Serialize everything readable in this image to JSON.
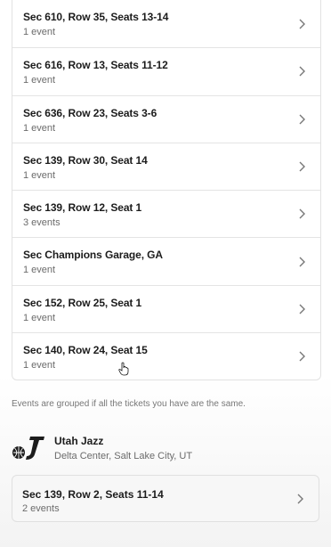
{
  "rows": [
    {
      "title": "Sec 610, Row 35, Seats 13-14",
      "sub": "1 event"
    },
    {
      "title": "Sec 616, Row 13, Seats 11-12",
      "sub": "1 event"
    },
    {
      "title": "Sec 636, Row 23, Seats 3-6",
      "sub": "1 event"
    },
    {
      "title": "Sec 139, Row 30, Seat 14",
      "sub": "1 event"
    },
    {
      "title": "Sec 139, Row 12, Seat 1",
      "sub": "3 events"
    },
    {
      "title": "Sec Champions Garage, GA",
      "sub": "1 event"
    },
    {
      "title": "Sec 152, Row 25, Seat 1",
      "sub": "1 event"
    },
    {
      "title": "Sec 140, Row 24, Seat 15",
      "sub": "1 event"
    }
  ],
  "note": "Events are grouped if all the tickets you have are the same.",
  "team": {
    "name": "Utah Jazz",
    "venue": "Delta Center, Salt Lake City, UT",
    "logo_icon": "utah-jazz-logo"
  },
  "team_rows": [
    {
      "title": "Sec 139, Row 2, Seats 11-14",
      "sub": "2 events"
    }
  ],
  "icons": {
    "chevron": "chevron-right-icon"
  },
  "colors": {
    "text": "#1c1c1c",
    "muted": "#6b6b6b",
    "border": "#e2e2e2"
  }
}
